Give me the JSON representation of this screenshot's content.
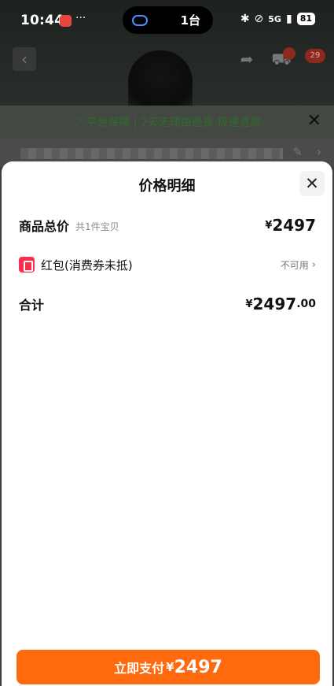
{
  "status_bar": {
    "time": "10:44",
    "dots": "···",
    "island_count": "1台",
    "network": "5G",
    "battery": "81"
  },
  "background_page": {
    "cart_badge": "",
    "message_badge": "29",
    "guarantee_text": "平台保障 | 7天无理由退货·极速退款"
  },
  "sheet": {
    "title": "价格明细",
    "total_label": "商品总价",
    "total_sub": "共1件宝贝",
    "total_currency": "¥",
    "total_value": "2497",
    "coupon_label": "红包(消费券未抵)",
    "coupon_status": "不可用",
    "sum_label": "合计",
    "sum_currency": "¥",
    "sum_value": "2497",
    "sum_decimal": ".00"
  },
  "pay_button": {
    "label": "立即支付",
    "currency": "¥",
    "value": "2497"
  },
  "colors": {
    "accent": "#ff6a0f",
    "coupon_red": "#ff2d4a"
  }
}
